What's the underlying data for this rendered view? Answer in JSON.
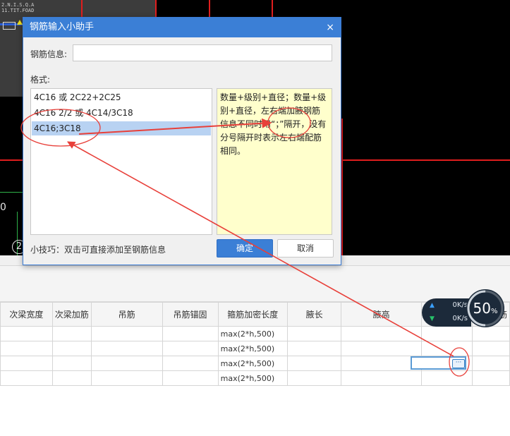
{
  "cad": {
    "overlay_lines": [
      "2.N.I.S.Q.A",
      "11.TIT.FOAD"
    ],
    "side_labels": [
      "0",
      "2"
    ]
  },
  "grid": {
    "columns": [
      "次梁宽度",
      "次梁加筋",
      "吊筋",
      "吊筋锚固",
      "箍筋加密长度",
      "腋长",
      "腋高",
      "",
      "筋"
    ],
    "rows": [
      [
        "",
        "",
        "",
        "",
        "max(2*h,500)",
        "",
        "",
        "",
        ""
      ],
      [
        "",
        "",
        "",
        "",
        "max(2*h,500)",
        "",
        "",
        "",
        ""
      ],
      [
        "",
        "",
        "",
        "",
        "max(2*h,500)",
        "",
        "",
        "",
        ""
      ],
      [
        "",
        "",
        "",
        "",
        "max(2*h,500)",
        "",
        "",
        "",
        ""
      ]
    ],
    "more_button": "···"
  },
  "speed": {
    "upload": "0K/s",
    "download": "0K/s",
    "percent": "50",
    "percent_unit": "%",
    "level": 0.5
  },
  "dialog": {
    "title": "钢筋输入小助手",
    "close": "×",
    "info_label": "钢筋信息:",
    "info_value": "",
    "format_label": "格式:",
    "formats": [
      "4C16 或 2C22+2C25",
      "4C16 2/2 或 4C14/3C18",
      "4C16;3C18"
    ],
    "selected_index": 2,
    "hint": "数量+级别+直径；数量+级别+直径，左右端加腋钢筋信息不同时用“；”隔开，没有分号隔开时表示左右端配筋相同。",
    "tip": "小技巧：双击可直接添加至钢筋信息",
    "ok": "确定",
    "cancel": "取消"
  },
  "colors": {
    "accent": "#3b7fd6",
    "annotation": "#e8403a",
    "hint_bg": "#ffffcc",
    "selection": "#b8d2f2"
  }
}
